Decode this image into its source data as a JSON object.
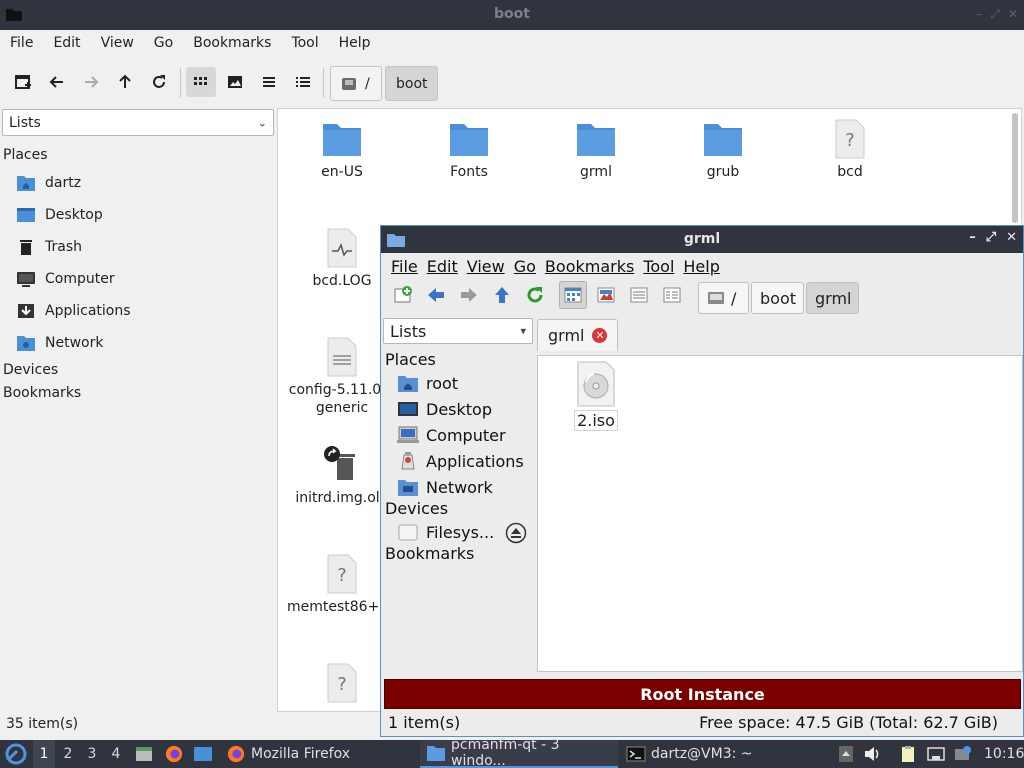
{
  "main": {
    "title": "boot",
    "menu": [
      "File",
      "Edit",
      "View",
      "Go",
      "Bookmarks",
      "Tool",
      "Help"
    ],
    "path": [
      "/",
      "boot"
    ],
    "side_combo": "Lists",
    "places_label": "Places",
    "places": [
      "dartz",
      "Desktop",
      "Trash",
      "Computer",
      "Applications",
      "Network"
    ],
    "devices_label": "Devices",
    "bookmarks_label": "Bookmarks",
    "files": [
      "en-US",
      "Fonts",
      "grml",
      "grub",
      "bcd",
      "bcd.LOG",
      "config-5.11.0-1",
      "generic",
      "initrd.img.old",
      "memtest86+.bin"
    ],
    "status": "35 item(s)"
  },
  "secondary": {
    "title": "grml",
    "menu": [
      "File",
      "Edit",
      "View",
      "Go",
      "Bookmarks",
      "Tool",
      "Help"
    ],
    "path": [
      "/",
      "boot",
      "grml"
    ],
    "side_combo": "Lists",
    "places_label": "Places",
    "places": [
      "root",
      "Desktop",
      "Computer",
      "Applications",
      "Network"
    ],
    "devices_label": "Devices",
    "devices": [
      "Filesys..."
    ],
    "bookmarks_label": "Bookmarks",
    "tab_label": "grml",
    "files": [
      "2.iso"
    ],
    "banner": "Root Instance",
    "status_left": "1 item(s)",
    "status_right": "Free space: 47.5 GiB (Total: 62.7 GiB)"
  },
  "taskbar": {
    "desktops": [
      "1",
      "2",
      "3",
      "4"
    ],
    "tasks": [
      "Mozilla Firefox",
      "pcmanfm-qt - 3 windo...",
      "dartz@VM3: ~"
    ],
    "clock": "10:16"
  },
  "colors": {
    "titlebar": "#2f343f",
    "folder": "#4a90d9",
    "root_banner": "#7a0000",
    "accent": "#5294e2"
  }
}
